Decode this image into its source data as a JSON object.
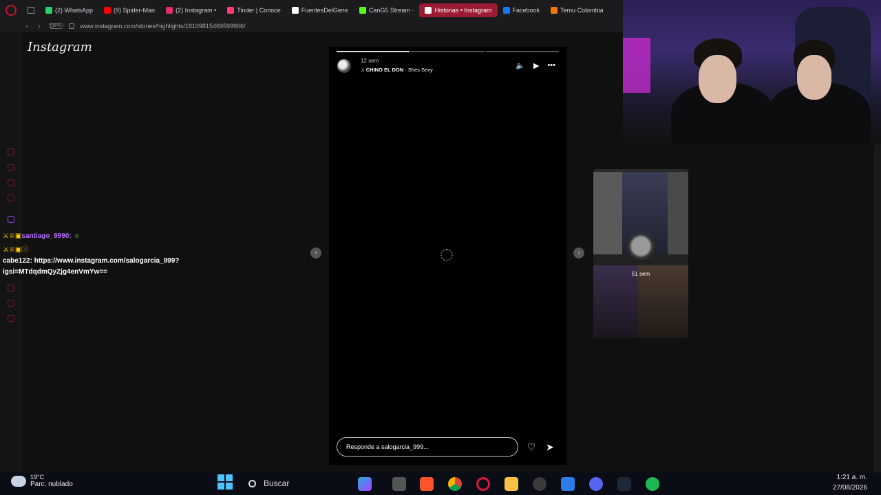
{
  "tabs": [
    {
      "label": "(2) WhatsApp",
      "color": "#25d366"
    },
    {
      "label": "(9) Spider-Man",
      "color": "#ff0000"
    },
    {
      "label": "(2) Instagram • ",
      "color": "#e1306c"
    },
    {
      "label": "Tinder | Conoce",
      "color": "#fe3c72"
    },
    {
      "label": "FuentesDelGene",
      "color": "#ffffff"
    },
    {
      "label": "CanG5 Stream · ",
      "color": "#53fc18"
    },
    {
      "label": "Historias • Instagram",
      "color": "#e1306c",
      "active": true
    },
    {
      "label": "Facebook",
      "color": "#1877f2"
    },
    {
      "label": "Temu Colombia",
      "color": "#fb7701"
    }
  ],
  "address": {
    "vpn": "VPN",
    "url": "www.instagram.com/stories/highlights/18109815469599966/"
  },
  "instagram": {
    "logo": "Instagram"
  },
  "story": {
    "time": "12 sem",
    "artist": "CHINO EL DON",
    "song": " · Shes Sexy",
    "reply_placeholder": "Responde a salogarcia_999...",
    "progress": [
      1,
      0,
      0
    ]
  },
  "next_story": {
    "time": "51 sem"
  },
  "chat": {
    "user1": "santiago_9990:",
    "user2": "cabe122:",
    "message_line1": "https://www.instagram.com/salogarcia_999?",
    "message_line2": "igsi=MTdqdmQyZjg4enVmYw=="
  },
  "taskbar": {
    "temp": "19°C",
    "weather": "Parc. nublado",
    "search": "Buscar",
    "time": "1:21 a. m.",
    "date": "27/08/2026"
  }
}
